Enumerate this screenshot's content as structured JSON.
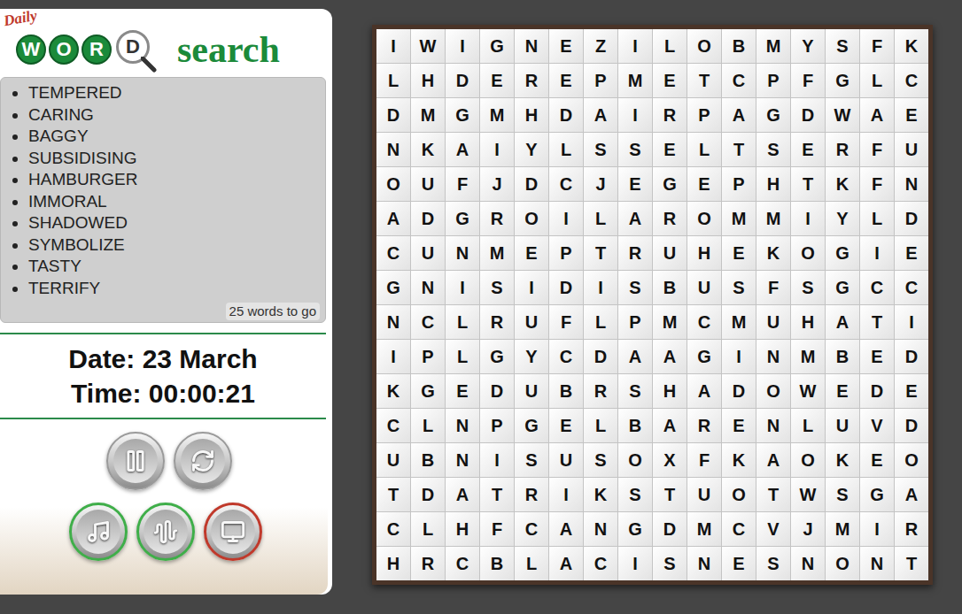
{
  "logo": {
    "script": "Daily",
    "letters": [
      {
        "char": "W",
        "kind": "disc"
      },
      {
        "char": "O",
        "kind": "disc"
      },
      {
        "char": "R",
        "kind": "disc"
      },
      {
        "char": "D",
        "kind": "lens"
      }
    ],
    "word": "search"
  },
  "words": [
    "TEMPERED",
    "CARING",
    "BAGGY",
    "SUBSIDISING",
    "HAMBURGER",
    "IMMORAL",
    "SHADOWED",
    "SYMBOLIZE",
    "TASTY",
    "TERRIFY"
  ],
  "remaining": "25 words to go",
  "date": "Date: 23 March",
  "time": "Time: 00:00:21",
  "controls": [
    {
      "kind": "pause"
    },
    {
      "kind": "refresh"
    }
  ],
  "toggles": [
    {
      "kind": "music",
      "on": true
    },
    {
      "kind": "sound",
      "on": true
    },
    {
      "kind": "fullscreen",
      "on": false
    }
  ],
  "grid": [
    "IWIGNEZILOBMYSFK",
    "LHDEREPMETCPFGLC",
    "DMGMHDAIRPAGDWAE",
    "NKAIYLSSELTSERFU",
    "OUFJDCJEGEPHTKFN",
    "ADGROILAROMMIYLD",
    "CUNMEPTRUHEKOGIE",
    "GNISIDISBUSFSGCC",
    "NCLRUFLPMCMUHATI",
    "IPLGYCDAAGINMBED",
    "KGEDUBRSHADOWEDE",
    "CLNPGELBARENLUVD",
    "UBNISUSOXFKAOKEO",
    "TDATRIKSTUOTWSGA",
    "CLHFCANGDMCVJMIR",
    "HRCBLACISNESNONT"
  ]
}
